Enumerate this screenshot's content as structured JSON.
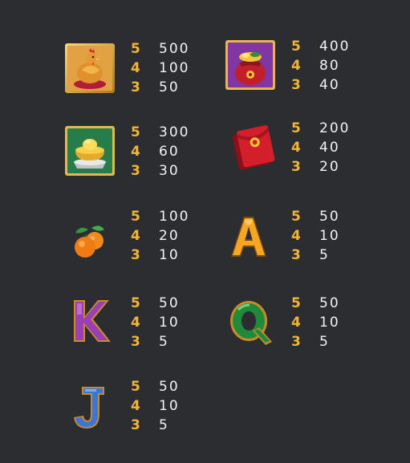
{
  "symbols": [
    {
      "name": "Rooster",
      "icon": "rooster-icon",
      "pays": [
        {
          "count": "5",
          "value": "500"
        },
        {
          "count": "4",
          "value": "100"
        },
        {
          "count": "3",
          "value": "50"
        }
      ]
    },
    {
      "name": "Treasure Pouch",
      "icon": "treasure-pouch-icon",
      "pays": [
        {
          "count": "5",
          "value": "400"
        },
        {
          "count": "4",
          "value": "80"
        },
        {
          "count": "3",
          "value": "40"
        }
      ]
    },
    {
      "name": "Gold Ingot",
      "icon": "gold-ingot-icon",
      "pays": [
        {
          "count": "5",
          "value": "300"
        },
        {
          "count": "4",
          "value": "60"
        },
        {
          "count": "3",
          "value": "30"
        }
      ]
    },
    {
      "name": "Red Envelope",
      "icon": "red-envelope-icon",
      "pays": [
        {
          "count": "5",
          "value": "200"
        },
        {
          "count": "4",
          "value": "40"
        },
        {
          "count": "3",
          "value": "20"
        }
      ]
    },
    {
      "name": "Oranges",
      "icon": "oranges-icon",
      "pays": [
        {
          "count": "5",
          "value": "100"
        },
        {
          "count": "4",
          "value": "20"
        },
        {
          "count": "3",
          "value": "10"
        }
      ]
    },
    {
      "name": "A",
      "icon": "letter-a-icon",
      "pays": [
        {
          "count": "5",
          "value": "50"
        },
        {
          "count": "4",
          "value": "10"
        },
        {
          "count": "3",
          "value": "5"
        }
      ]
    },
    {
      "name": "K",
      "icon": "letter-k-icon",
      "pays": [
        {
          "count": "5",
          "value": "50"
        },
        {
          "count": "4",
          "value": "10"
        },
        {
          "count": "3",
          "value": "5"
        }
      ]
    },
    {
      "name": "Q",
      "icon": "letter-q-icon",
      "pays": [
        {
          "count": "5",
          "value": "50"
        },
        {
          "count": "4",
          "value": "10"
        },
        {
          "count": "3",
          "value": "5"
        }
      ]
    },
    {
      "name": "J",
      "icon": "letter-j-icon",
      "pays": [
        {
          "count": "5",
          "value": "50"
        },
        {
          "count": "4",
          "value": "10"
        },
        {
          "count": "3",
          "value": "5"
        }
      ]
    }
  ],
  "colors": {
    "background": "#2b2d31",
    "count": "#f3b634",
    "payout": "#f2f2f2",
    "letter_a": "#f5a623",
    "letter_k": "#9b3fb5",
    "letter_q": "#1e8a3a",
    "letter_j": "#3a76d8"
  }
}
